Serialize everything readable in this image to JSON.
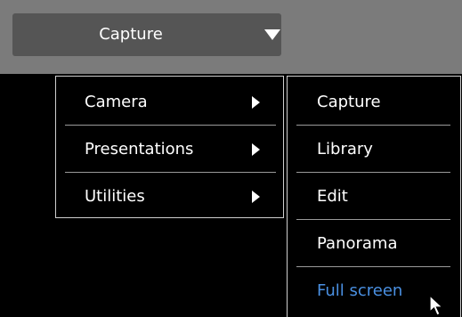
{
  "toolbar": {
    "dropdown_label": "Capture"
  },
  "main_menu": {
    "items": [
      {
        "label": "Camera"
      },
      {
        "label": "Presentations"
      },
      {
        "label": "Utilities"
      }
    ]
  },
  "sub_menu": {
    "items": [
      {
        "label": "Capture"
      },
      {
        "label": "Library"
      },
      {
        "label": "Edit"
      },
      {
        "label": "Panorama"
      },
      {
        "label": "Full screen"
      }
    ]
  },
  "colors": {
    "toolbar_bg": "#7b7b7b",
    "dropdown_bg": "#555555",
    "menu_bg": "#000000",
    "highlight_text": "#4a90e2"
  },
  "icons": {
    "dropdown": "triangle-down-icon",
    "submenu": "triangle-right-icon",
    "pointer": "mouse-pointer-icon"
  }
}
